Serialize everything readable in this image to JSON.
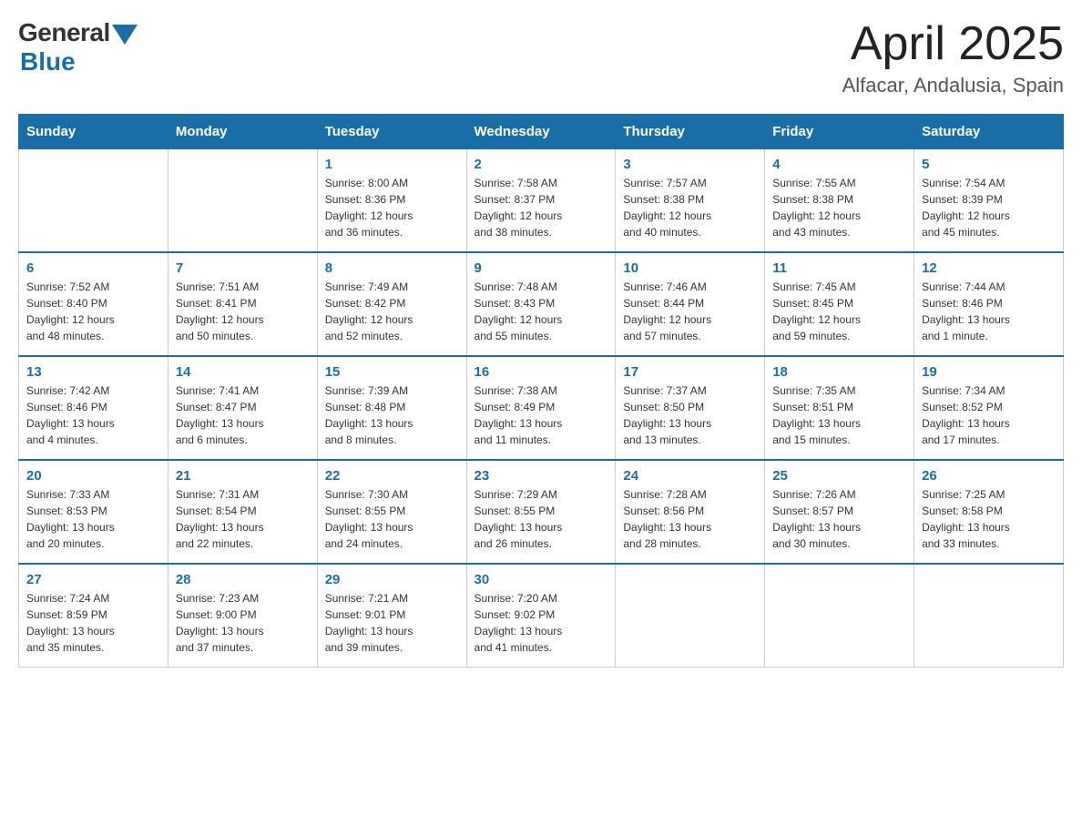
{
  "header": {
    "logo_general": "General",
    "logo_blue": "Blue",
    "month_year": "April 2025",
    "location": "Alfacar, Andalusia, Spain"
  },
  "days_of_week": [
    "Sunday",
    "Monday",
    "Tuesday",
    "Wednesday",
    "Thursday",
    "Friday",
    "Saturday"
  ],
  "weeks": [
    [
      {
        "day": "",
        "info": ""
      },
      {
        "day": "",
        "info": ""
      },
      {
        "day": "1",
        "info": "Sunrise: 8:00 AM\nSunset: 8:36 PM\nDaylight: 12 hours\nand 36 minutes."
      },
      {
        "day": "2",
        "info": "Sunrise: 7:58 AM\nSunset: 8:37 PM\nDaylight: 12 hours\nand 38 minutes."
      },
      {
        "day": "3",
        "info": "Sunrise: 7:57 AM\nSunset: 8:38 PM\nDaylight: 12 hours\nand 40 minutes."
      },
      {
        "day": "4",
        "info": "Sunrise: 7:55 AM\nSunset: 8:38 PM\nDaylight: 12 hours\nand 43 minutes."
      },
      {
        "day": "5",
        "info": "Sunrise: 7:54 AM\nSunset: 8:39 PM\nDaylight: 12 hours\nand 45 minutes."
      }
    ],
    [
      {
        "day": "6",
        "info": "Sunrise: 7:52 AM\nSunset: 8:40 PM\nDaylight: 12 hours\nand 48 minutes."
      },
      {
        "day": "7",
        "info": "Sunrise: 7:51 AM\nSunset: 8:41 PM\nDaylight: 12 hours\nand 50 minutes."
      },
      {
        "day": "8",
        "info": "Sunrise: 7:49 AM\nSunset: 8:42 PM\nDaylight: 12 hours\nand 52 minutes."
      },
      {
        "day": "9",
        "info": "Sunrise: 7:48 AM\nSunset: 8:43 PM\nDaylight: 12 hours\nand 55 minutes."
      },
      {
        "day": "10",
        "info": "Sunrise: 7:46 AM\nSunset: 8:44 PM\nDaylight: 12 hours\nand 57 minutes."
      },
      {
        "day": "11",
        "info": "Sunrise: 7:45 AM\nSunset: 8:45 PM\nDaylight: 12 hours\nand 59 minutes."
      },
      {
        "day": "12",
        "info": "Sunrise: 7:44 AM\nSunset: 8:46 PM\nDaylight: 13 hours\nand 1 minute."
      }
    ],
    [
      {
        "day": "13",
        "info": "Sunrise: 7:42 AM\nSunset: 8:46 PM\nDaylight: 13 hours\nand 4 minutes."
      },
      {
        "day": "14",
        "info": "Sunrise: 7:41 AM\nSunset: 8:47 PM\nDaylight: 13 hours\nand 6 minutes."
      },
      {
        "day": "15",
        "info": "Sunrise: 7:39 AM\nSunset: 8:48 PM\nDaylight: 13 hours\nand 8 minutes."
      },
      {
        "day": "16",
        "info": "Sunrise: 7:38 AM\nSunset: 8:49 PM\nDaylight: 13 hours\nand 11 minutes."
      },
      {
        "day": "17",
        "info": "Sunrise: 7:37 AM\nSunset: 8:50 PM\nDaylight: 13 hours\nand 13 minutes."
      },
      {
        "day": "18",
        "info": "Sunrise: 7:35 AM\nSunset: 8:51 PM\nDaylight: 13 hours\nand 15 minutes."
      },
      {
        "day": "19",
        "info": "Sunrise: 7:34 AM\nSunset: 8:52 PM\nDaylight: 13 hours\nand 17 minutes."
      }
    ],
    [
      {
        "day": "20",
        "info": "Sunrise: 7:33 AM\nSunset: 8:53 PM\nDaylight: 13 hours\nand 20 minutes."
      },
      {
        "day": "21",
        "info": "Sunrise: 7:31 AM\nSunset: 8:54 PM\nDaylight: 13 hours\nand 22 minutes."
      },
      {
        "day": "22",
        "info": "Sunrise: 7:30 AM\nSunset: 8:55 PM\nDaylight: 13 hours\nand 24 minutes."
      },
      {
        "day": "23",
        "info": "Sunrise: 7:29 AM\nSunset: 8:55 PM\nDaylight: 13 hours\nand 26 minutes."
      },
      {
        "day": "24",
        "info": "Sunrise: 7:28 AM\nSunset: 8:56 PM\nDaylight: 13 hours\nand 28 minutes."
      },
      {
        "day": "25",
        "info": "Sunrise: 7:26 AM\nSunset: 8:57 PM\nDaylight: 13 hours\nand 30 minutes."
      },
      {
        "day": "26",
        "info": "Sunrise: 7:25 AM\nSunset: 8:58 PM\nDaylight: 13 hours\nand 33 minutes."
      }
    ],
    [
      {
        "day": "27",
        "info": "Sunrise: 7:24 AM\nSunset: 8:59 PM\nDaylight: 13 hours\nand 35 minutes."
      },
      {
        "day": "28",
        "info": "Sunrise: 7:23 AM\nSunset: 9:00 PM\nDaylight: 13 hours\nand 37 minutes."
      },
      {
        "day": "29",
        "info": "Sunrise: 7:21 AM\nSunset: 9:01 PM\nDaylight: 13 hours\nand 39 minutes."
      },
      {
        "day": "30",
        "info": "Sunrise: 7:20 AM\nSunset: 9:02 PM\nDaylight: 13 hours\nand 41 minutes."
      },
      {
        "day": "",
        "info": ""
      },
      {
        "day": "",
        "info": ""
      },
      {
        "day": "",
        "info": ""
      }
    ]
  ]
}
